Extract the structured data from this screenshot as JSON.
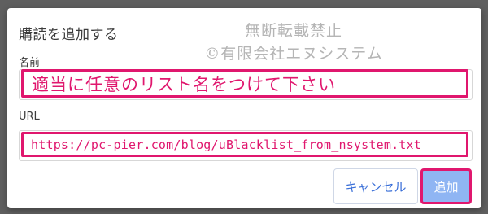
{
  "dialog": {
    "title": "購読を追加する",
    "watermark_line1": "無断転載禁止",
    "watermark_line2": "©有限会社エヌシステム",
    "name_label": "名前",
    "name_value": "適当に任意のリスト名をつけて下さい",
    "url_label": "URL",
    "url_value": "https://pc-pier.com/blog/uBlacklist_from_nsystem.txt",
    "cancel_label": "キャンセル",
    "add_label": "追加"
  },
  "colors": {
    "highlight": "#e0176e",
    "primary_button": "#8fb5f3",
    "cancel_text": "#3a6fd8",
    "backdrop": "#5f5f5f"
  }
}
